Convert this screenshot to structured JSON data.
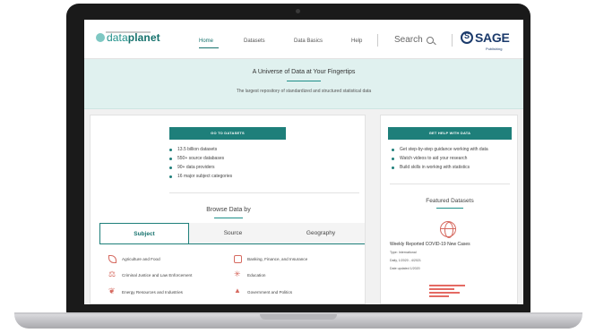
{
  "header": {
    "logo_text_light": "data",
    "logo_text_bold": "planet",
    "nav": [
      "Home",
      "Datasets",
      "Data Basics",
      "Help"
    ],
    "active_nav": "Home",
    "search_label": "Search",
    "publisher_name": "SAGE",
    "publisher_sub": "Publishing"
  },
  "banner": {
    "title": "A Universe of Data at Your Fingertips",
    "subtitle": "The largest repository of standardized and structured statistical data"
  },
  "datasets_card": {
    "cta_label": "GO TO DATASETS",
    "bullets": [
      "13.5 billion datasets",
      "550+ source databases",
      "90+ data providers",
      "16 major subject categories"
    ],
    "browse_title": "Browse Data by",
    "tabs": [
      "Subject",
      "Source",
      "Geography"
    ],
    "active_tab": "Subject",
    "categories": [
      "Agriculture and Food",
      "Banking, Finance, and Insurance",
      "Criminal Justice and Law Enforcement",
      "Education",
      "Energy Resources and Industries",
      "Government and Politics"
    ]
  },
  "help_card": {
    "cta_label": "GET HELP WITH DATA",
    "bullets": [
      "Get step-by-step guidance working with data",
      "Watch videos to aid your research",
      "Build skills in working with statistics"
    ],
    "featured_title": "Featured Datasets",
    "featured_name": "Weekly Reported COVID-19 New Cases",
    "featured_type": "Type: International",
    "featured_range": "Daily, 1/2020 - 4/2021",
    "featured_updated": "Date updated 1/2020"
  },
  "icons": {
    "brand_color": "#1e7f7a",
    "accent_icon_color": "#d66a60",
    "sage_color": "#1b3a6b"
  }
}
